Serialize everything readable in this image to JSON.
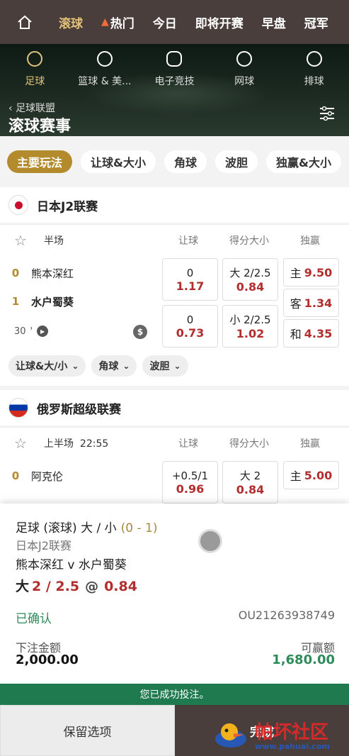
{
  "nav": {
    "tabs": [
      {
        "label": "滚球"
      },
      {
        "label": "热门"
      },
      {
        "label": "今日"
      },
      {
        "label": "即将开赛"
      },
      {
        "label": "早盘"
      },
      {
        "label": "冠军"
      }
    ]
  },
  "sports": [
    {
      "label": "足球"
    },
    {
      "label": "篮球 & 美..."
    },
    {
      "label": "电子竞技"
    },
    {
      "label": "网球"
    },
    {
      "label": "排球"
    }
  ],
  "header": {
    "breadcrumb": "足球联盟",
    "title": "滚球赛事"
  },
  "market_tabs": [
    "主要玩法",
    "让球&大小",
    "角球",
    "波胆",
    "独赢&大小"
  ],
  "leagues": [
    {
      "name": "日本J2联赛",
      "match": {
        "period": "半场",
        "col_handicap": "让球",
        "col_total": "得分大小",
        "col_moneyline": "独赢",
        "home": {
          "score": "0",
          "name": "熊本深红"
        },
        "away": {
          "score": "1",
          "name": "水户蜀葵"
        },
        "minute": "30",
        "handicap": [
          {
            "line": "0",
            "price": "1.17"
          },
          {
            "line": "0",
            "price": "0.73"
          }
        ],
        "total": [
          {
            "line": "大 2/2.5",
            "price": "0.84"
          },
          {
            "line": "小 2/2.5",
            "price": "1.02"
          }
        ],
        "moneyline": [
          {
            "label": "主",
            "price": "9.50"
          },
          {
            "label": "客",
            "price": "1.34"
          },
          {
            "label": "和",
            "price": "4.35"
          }
        ],
        "chips": [
          "让球&大/小",
          "角球",
          "波胆"
        ]
      }
    },
    {
      "name": "俄罗斯超级联赛",
      "match": {
        "period": "上半场",
        "time": "22:55",
        "col_handicap": "让球",
        "col_total": "得分大小",
        "col_moneyline": "独赢",
        "home": {
          "score": "0",
          "name": "阿克伦"
        },
        "handicap": [
          {
            "line": "+0.5/1",
            "price": "0.96"
          }
        ],
        "total": [
          {
            "line": "大 2",
            "price": "0.84"
          }
        ],
        "moneyline": [
          {
            "label": "主",
            "price": "5.00"
          }
        ]
      }
    }
  ],
  "receipt": {
    "market": "足球 (滚球) 大 / 小",
    "score": "(0 - 1)",
    "league": "日本J2联赛",
    "fixture": "熊本深红 v 水户蜀葵",
    "selection": "大",
    "handicap": "2 / 2.5",
    "at": "@",
    "odds": "0.84",
    "status": "已确认",
    "bet_id": "OU21263938749",
    "stake_label": "下注金额",
    "stake": "2,000.00",
    "win_label": "可赢额",
    "win": "1,680.00"
  },
  "success_msg": "您已成功投注。",
  "buttons": {
    "keep": "保留选项",
    "done": "完成"
  },
  "watermark": {
    "text": "帕坏社区",
    "url": "www.pahuai.com"
  },
  "colors": {
    "accent": "#b48b2c",
    "odds": "#b22d2d",
    "success": "#1f7a4f",
    "nav_bg": "#4a3e3c"
  }
}
